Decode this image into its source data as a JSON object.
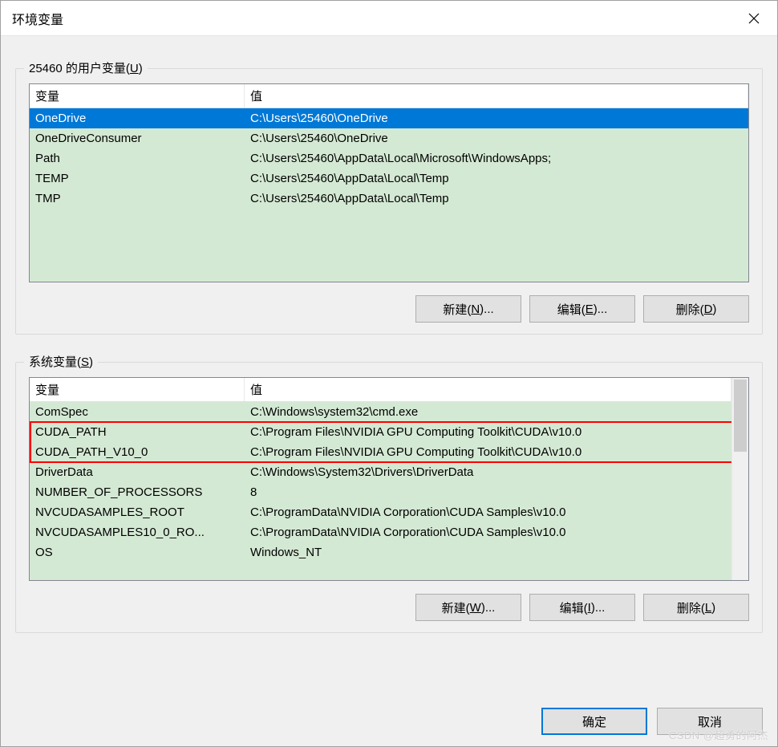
{
  "window": {
    "title": "环境变量"
  },
  "user_group": {
    "legend_prefix": "25460 的用户变量(",
    "legend_hotkey": "U",
    "legend_suffix": ")",
    "columns": {
      "variable": "变量",
      "value": "值"
    },
    "rows": [
      {
        "variable": "OneDrive",
        "value": "C:\\Users\\25460\\OneDrive",
        "selected": true
      },
      {
        "variable": "OneDriveConsumer",
        "value": "C:\\Users\\25460\\OneDrive"
      },
      {
        "variable": "Path",
        "value": "C:\\Users\\25460\\AppData\\Local\\Microsoft\\WindowsApps;"
      },
      {
        "variable": "TEMP",
        "value": "C:\\Users\\25460\\AppData\\Local\\Temp"
      },
      {
        "variable": "TMP",
        "value": "C:\\Users\\25460\\AppData\\Local\\Temp"
      }
    ],
    "buttons": {
      "new": {
        "label": "新建(",
        "hotkey": "N",
        "suffix": ")..."
      },
      "edit": {
        "label": "编辑(",
        "hotkey": "E",
        "suffix": ")..."
      },
      "delete": {
        "label": "删除(",
        "hotkey": "D",
        "suffix": ")"
      }
    }
  },
  "sys_group": {
    "legend_prefix": "系统变量(",
    "legend_hotkey": "S",
    "legend_suffix": ")",
    "columns": {
      "variable": "变量",
      "value": "值"
    },
    "rows": [
      {
        "variable": "ComSpec",
        "value": "C:\\Windows\\system32\\cmd.exe"
      },
      {
        "variable": "CUDA_PATH",
        "value": "C:\\Program Files\\NVIDIA GPU Computing Toolkit\\CUDA\\v10.0",
        "highlight": true
      },
      {
        "variable": "CUDA_PATH_V10_0",
        "value": "C:\\Program Files\\NVIDIA GPU Computing Toolkit\\CUDA\\v10.0",
        "highlight": true
      },
      {
        "variable": "DriverData",
        "value": "C:\\Windows\\System32\\Drivers\\DriverData"
      },
      {
        "variable": "NUMBER_OF_PROCESSORS",
        "value": "8"
      },
      {
        "variable": "NVCUDASAMPLES_ROOT",
        "value": "C:\\ProgramData\\NVIDIA Corporation\\CUDA Samples\\v10.0"
      },
      {
        "variable": "NVCUDASAMPLES10_0_RO...",
        "value": "C:\\ProgramData\\NVIDIA Corporation\\CUDA Samples\\v10.0"
      },
      {
        "variable": "OS",
        "value": "Windows_NT"
      }
    ],
    "buttons": {
      "new": {
        "label": "新建(",
        "hotkey": "W",
        "suffix": ")..."
      },
      "edit": {
        "label": "编辑(",
        "hotkey": "I",
        "suffix": ")..."
      },
      "delete": {
        "label": "删除(",
        "hotkey": "L",
        "suffix": ")"
      }
    }
  },
  "dialog_buttons": {
    "ok": "确定",
    "cancel": "取消"
  },
  "watermark": "CSDN @超勇的阿杰"
}
